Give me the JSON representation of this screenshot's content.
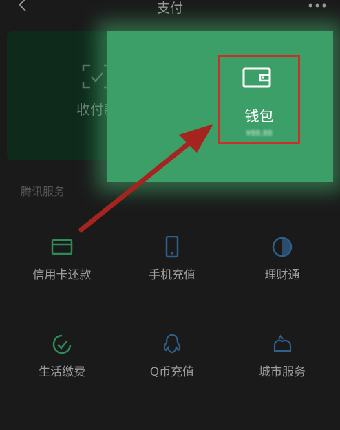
{
  "header": {
    "title": "支付",
    "back_icon": "chevron-left-icon",
    "more_icon": "more-dots-icon"
  },
  "pay_card": {
    "scan_label": "收付款",
    "scan_icon": "scan-qr-icon",
    "wallet_label": "钱包",
    "wallet_icon": "wallet-icon",
    "wallet_balance": "¥88.88",
    "highlight_color": "#c9302c",
    "card_color": "#3c9f68"
  },
  "services": {
    "section_title": "腾讯服务",
    "items": [
      {
        "label": "信用卡还款",
        "icon": "credit-card-icon"
      },
      {
        "label": "手机充值",
        "icon": "phone-icon"
      },
      {
        "label": "理财通",
        "icon": "finance-icon"
      },
      {
        "label": "生活缴费",
        "icon": "utility-icon"
      },
      {
        "label": "Q币充值",
        "icon": "qq-penguin-icon"
      },
      {
        "label": "城市服务",
        "icon": "city-icon"
      }
    ]
  }
}
